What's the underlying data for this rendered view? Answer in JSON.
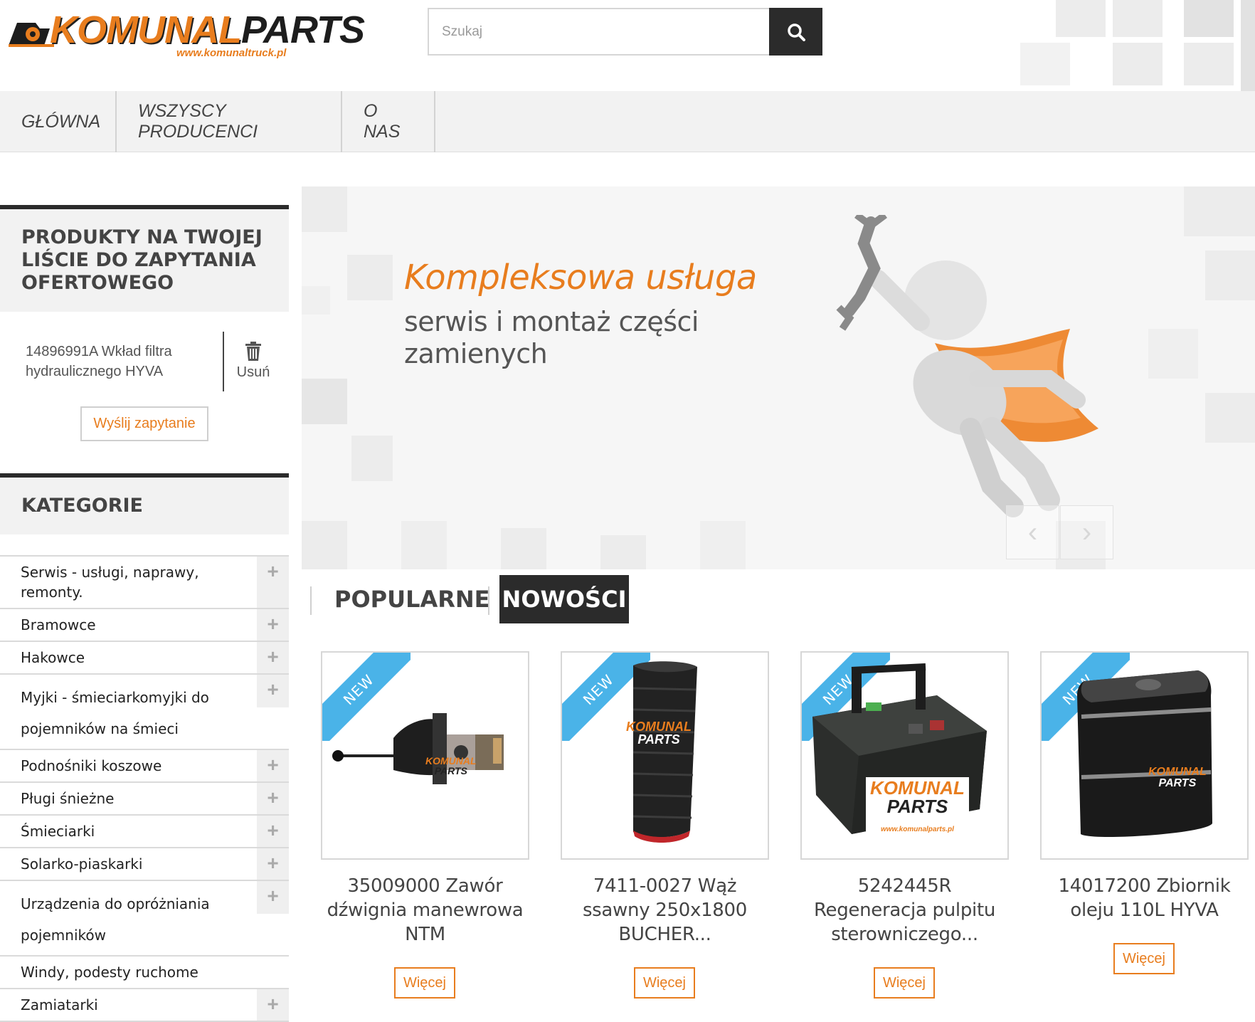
{
  "header": {
    "logo_brand_a": "KOMUNAL",
    "logo_brand_b": "PARTS",
    "logo_url": "www.komunaltruck.pl",
    "search_placeholder": "Szukaj"
  },
  "nav": {
    "items": [
      {
        "label": "GŁÓWNA"
      },
      {
        "label": "WSZYSCY PRODUCENCI"
      },
      {
        "label": "O NAS"
      }
    ]
  },
  "quote_list": {
    "title": "PRODUKTY NA TWOJEJ LIŚCIE DO ZAPYTANIA OFERTOWEGO",
    "item": "14896991A Wkład filtra hydraulicznego HYVA",
    "remove_label": "Usuń",
    "send_label": "Wyślij zapytanie"
  },
  "categories": {
    "title": "KATEGORIE",
    "items": [
      {
        "label": "Serwis - usługi, naprawy, remonty."
      },
      {
        "label": "Bramowce"
      },
      {
        "label": "Hakowce"
      },
      {
        "label": "Myjki - śmieciarkomyjki do pojemników na śmieci"
      },
      {
        "label": "Podnośniki koszowe"
      },
      {
        "label": "Pługi śnieżne"
      },
      {
        "label": "Śmieciarki"
      },
      {
        "label": "Solarko-piaskarki"
      },
      {
        "label": "Urządzenia do opróżniania pojemników"
      },
      {
        "label": "Windy, podesty ruchome"
      },
      {
        "label": "Zamiatarki"
      }
    ]
  },
  "hero": {
    "headline": "Kompleksowa usługa",
    "subline": "serwis i montaż części zamienych"
  },
  "tabs": {
    "popular": "POPULARNE",
    "new": "NOWOŚCI"
  },
  "products": {
    "badge": "NEW",
    "more_label": "Więcej",
    "watermark_a": "KOMUNAL",
    "watermark_b": "PARTS",
    "watermark_url": "www.komunalparts.pl",
    "items": [
      {
        "name": "35009000 Zawór dźwignia manewrowa NTM"
      },
      {
        "name": "7411-0027 Wąż ssawny 250x1800 BUCHER..."
      },
      {
        "name": "5242445R Regeneracja pulpitu sterowniczego..."
      },
      {
        "name": "14017200 Zbiornik oleju 110L HYVA"
      }
    ]
  },
  "colors": {
    "accent": "#e87d1e",
    "dark": "#2b2b2b",
    "ribbon": "#4ab3e8"
  },
  "icons": [
    "search-icon",
    "trash-icon",
    "plus-icon",
    "chevron-left-icon",
    "chevron-right-icon"
  ]
}
